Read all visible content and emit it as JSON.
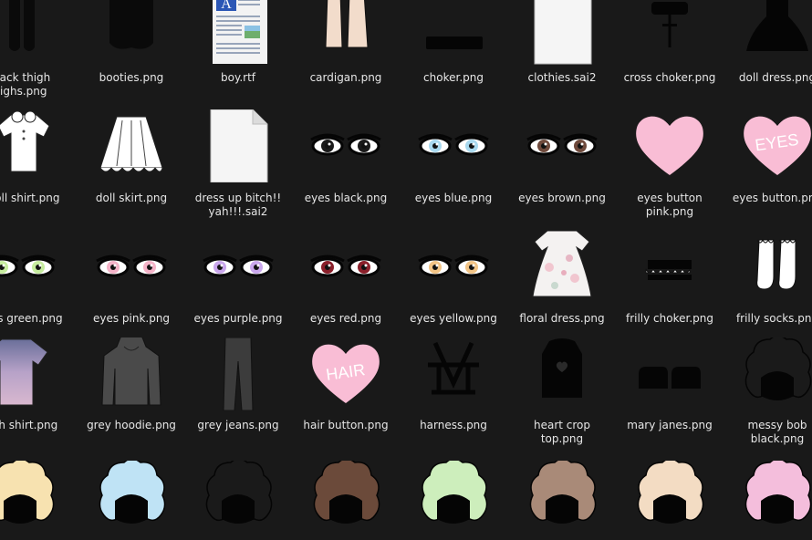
{
  "files": [
    {
      "name": "black thigh\nhighs.png",
      "icon": "black-thigh-highs-thumbnail"
    },
    {
      "name": "booties.png",
      "icon": "booties-thumbnail"
    },
    {
      "name": "boy.rtf",
      "icon": "rtf-document-icon"
    },
    {
      "name": "cardigan.png",
      "icon": "cardigan-thumbnail"
    },
    {
      "name": "choker.png",
      "icon": "choker-thumbnail"
    },
    {
      "name": "clothies.sai2",
      "icon": "blank-file-icon"
    },
    {
      "name": "cross choker.png",
      "icon": "cross-choker-thumbnail"
    },
    {
      "name": "doll dress.png",
      "icon": "doll-dress-thumbnail"
    },
    {
      "name": "doll shirt.png",
      "icon": "doll-shirt-thumbnail"
    },
    {
      "name": "doll skirt.png",
      "icon": "doll-skirt-thumbnail"
    },
    {
      "name": "dress up bitch!!\nyah!!!.sai2",
      "icon": "blank-file-icon"
    },
    {
      "name": "eyes black.png",
      "icon": "eyes-black-thumbnail"
    },
    {
      "name": "eyes blue.png",
      "icon": "eyes-blue-thumbnail"
    },
    {
      "name": "eyes brown.png",
      "icon": "eyes-brown-thumbnail"
    },
    {
      "name": "eyes button\npink.png",
      "icon": "pink-heart-thumbnail"
    },
    {
      "name": "eyes button.png",
      "icon": "eyes-heart-button-thumbnail"
    },
    {
      "name": "eyes green.png",
      "icon": "eyes-green-thumbnail"
    },
    {
      "name": "eyes pink.png",
      "icon": "eyes-pink-thumbnail"
    },
    {
      "name": "eyes purple.png",
      "icon": "eyes-purple-thumbnail"
    },
    {
      "name": "eyes red.png",
      "icon": "eyes-red-thumbnail"
    },
    {
      "name": "eyes yellow.png",
      "icon": "eyes-yellow-thumbnail"
    },
    {
      "name": "floral dress.png",
      "icon": "floral-dress-thumbnail"
    },
    {
      "name": "frilly choker.png",
      "icon": "frilly-choker-thumbnail"
    },
    {
      "name": "frilly socks.png",
      "icon": "frilly-socks-thumbnail"
    },
    {
      "name": "glitch shirt.png",
      "icon": "glitch-shirt-thumbnail"
    },
    {
      "name": "grey hoodie.png",
      "icon": "grey-hoodie-thumbnail"
    },
    {
      "name": "grey jeans.png",
      "icon": "grey-jeans-thumbnail"
    },
    {
      "name": "hair button.png",
      "icon": "hair-heart-button-thumbnail"
    },
    {
      "name": "harness.png",
      "icon": "harness-thumbnail"
    },
    {
      "name": "heart crop\ntop.png",
      "icon": "heart-crop-top-thumbnail"
    },
    {
      "name": "mary janes.png",
      "icon": "mary-janes-thumbnail"
    },
    {
      "name": "messy bob\nblack.png",
      "icon": "messy-bob-black-thumbnail"
    },
    {
      "name": "",
      "icon": "messy-bob-blonde-thumbnail"
    },
    {
      "name": "",
      "icon": "messy-bob-blue-thumbnail"
    },
    {
      "name": "",
      "icon": "messy-bob-black-outline-thumbnail"
    },
    {
      "name": "",
      "icon": "messy-bob-brown-thumbnail"
    },
    {
      "name": "",
      "icon": "messy-bob-green-thumbnail"
    },
    {
      "name": "",
      "icon": "messy-bob-light-brown-thumbnail"
    },
    {
      "name": "",
      "icon": "messy-bob-peach-thumbnail"
    },
    {
      "name": "",
      "icon": "messy-bob-pink-thumbnail"
    }
  ],
  "hair_colors": [
    "#f7e2b0",
    "#bfe3f5",
    "#141414",
    "#6b4a3a",
    "#cdeebc",
    "#a98a78",
    "#f3dcc3",
    "#f4bedc"
  ],
  "eye_colors": {
    "black": "#1a1a1a",
    "blue": "#a9d9ef",
    "brown": "#6f4a3c",
    "green": "#c6ec9e",
    "pink": "#f5b3c8",
    "purple": "#c9a6ec",
    "red": "#8a1f2a",
    "yellow": "#f2c486"
  },
  "accent": {
    "heart_pink": "#f9bdd5",
    "heart_text": "#ffffff"
  },
  "heart_texts": {
    "eyes": "EYES",
    "hair": "HAIR"
  }
}
